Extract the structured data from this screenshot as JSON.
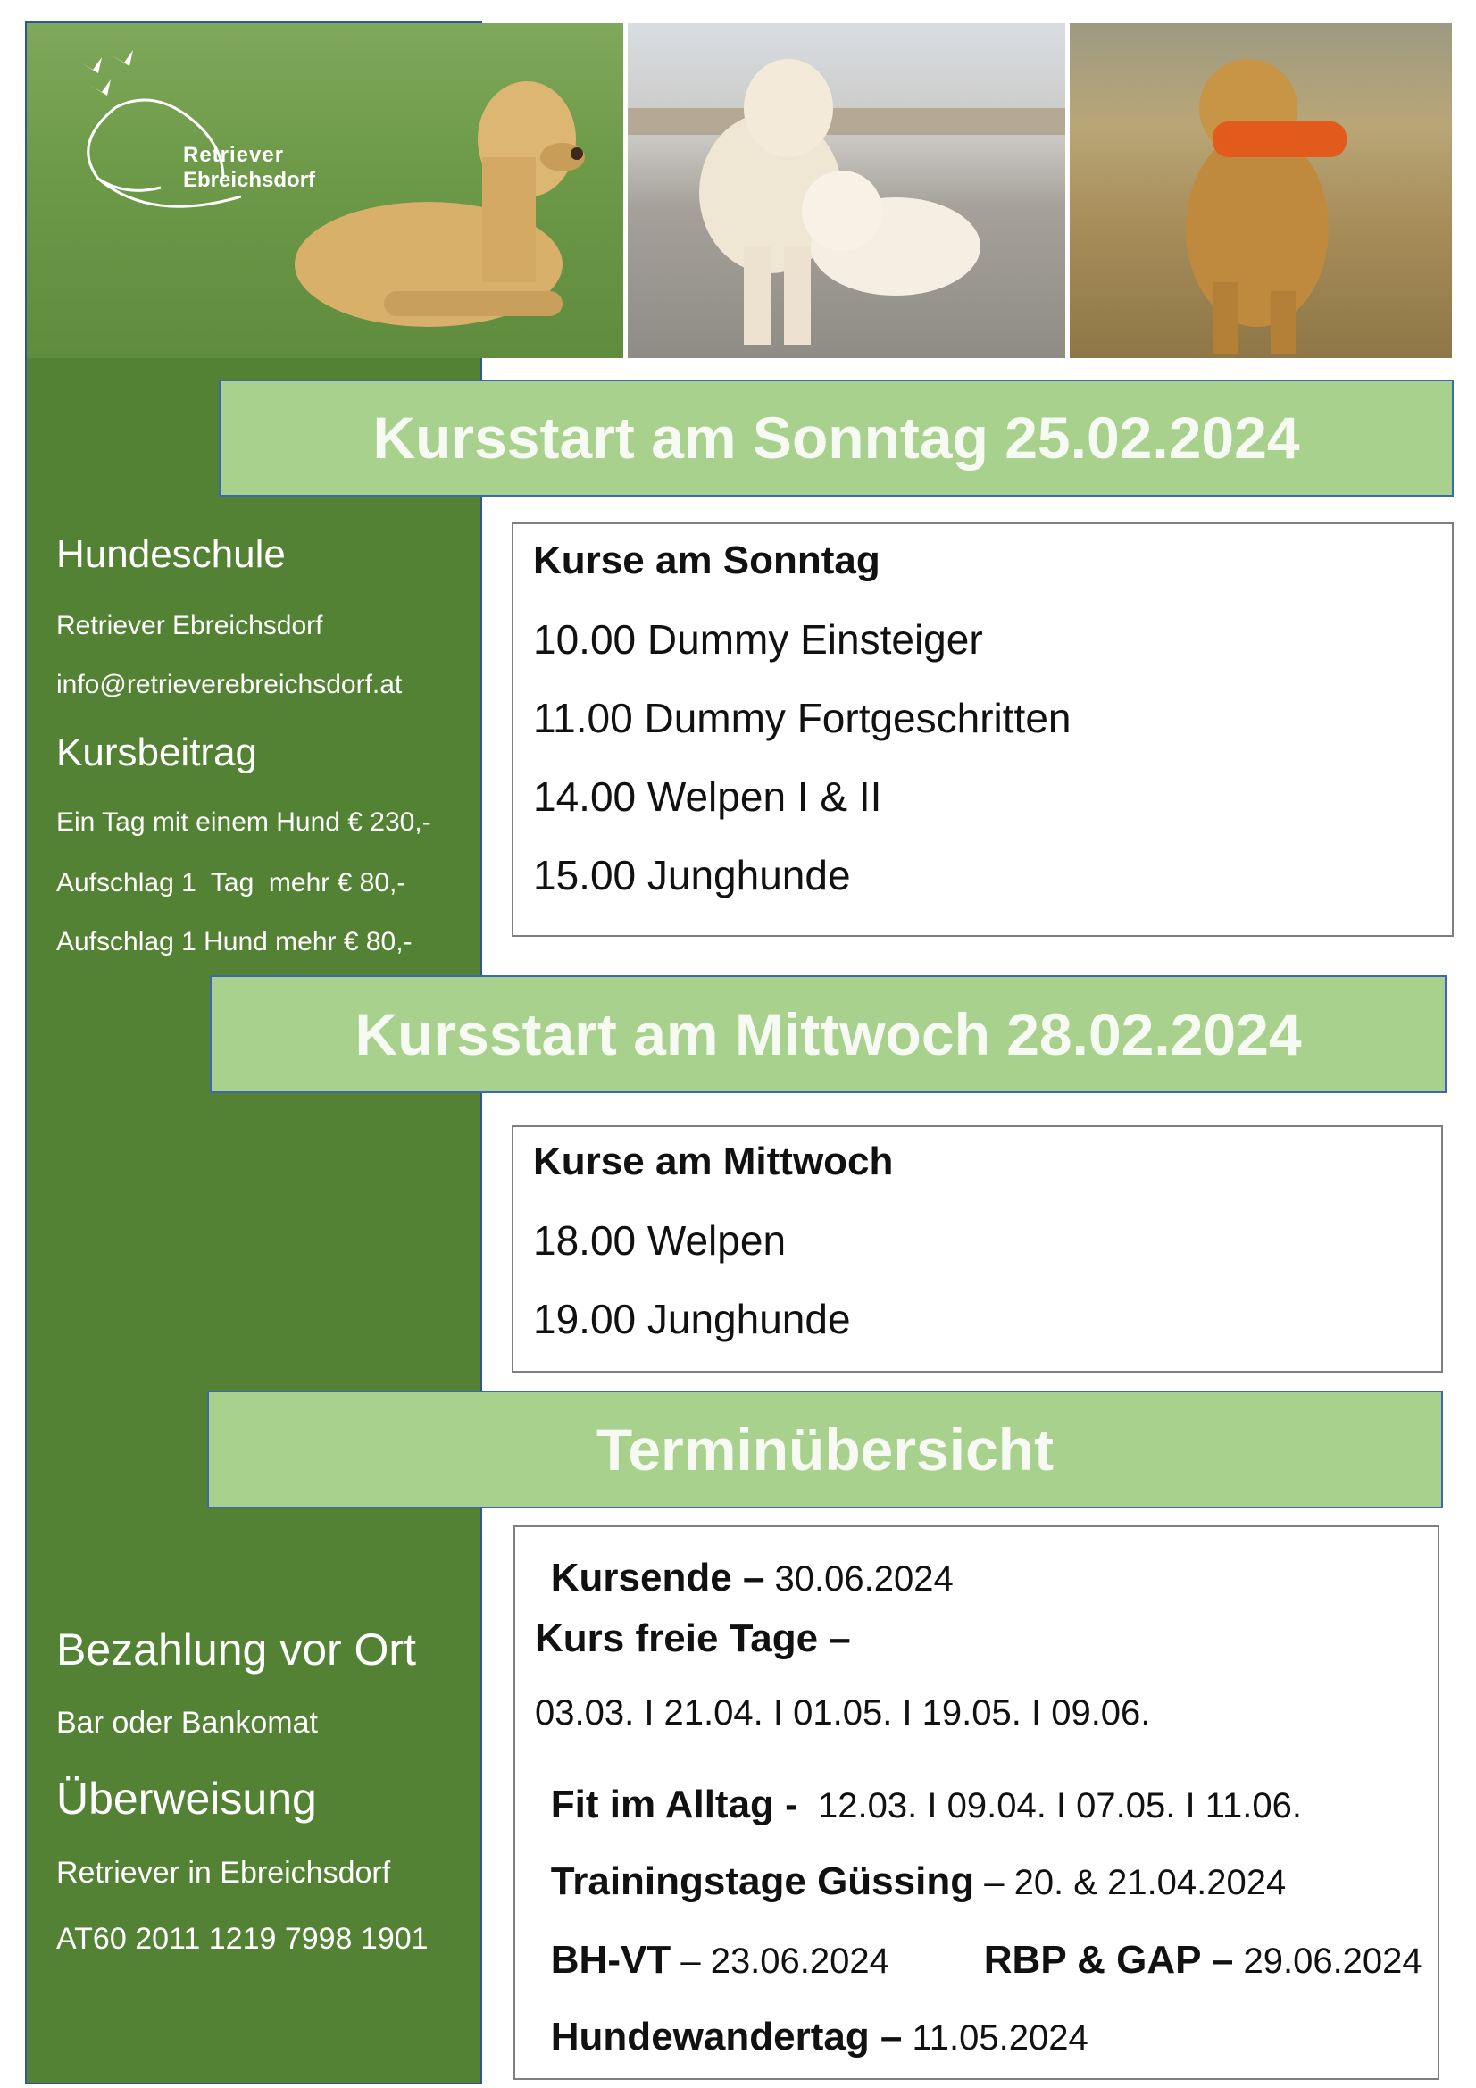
{
  "logo": {
    "line1": "Retriever",
    "line2": "Ebreichsdorf"
  },
  "bands": {
    "sunday": "Kursstart am Sonntag 25.02.2024",
    "wednesday": "Kursstart am Mittwoch 28.02.2024",
    "overview": "Terminübersicht"
  },
  "sidebar": {
    "school_heading": "Hundeschule",
    "school_name": "Retriever Ebreichsdorf",
    "email": "info@retrieverebreichsdorf.at",
    "fee_heading": "Kursbeitrag",
    "fee_1": "Ein Tag mit einem Hund € 230,-",
    "fee_2": "Aufschlag 1  Tag  mehr € 80,-",
    "fee_3": "Aufschlag 1 Hund mehr € 80,-",
    "payment_heading": "Bezahlung vor Ort",
    "payment_methods": "Bar oder Bankomat",
    "transfer_heading": "Überweisung",
    "transfer_name": "Retriever in Ebreichsdorf",
    "iban": "AT60 2011 1219 7998 1901"
  },
  "sunday_courses": {
    "heading": "Kurse am Sonntag",
    "items": [
      "10.00 Dummy Einsteiger",
      "11.00 Dummy Fortgeschritten",
      "14.00 Welpen I & II",
      "15.00 Junghunde"
    ]
  },
  "wednesday_courses": {
    "heading": "Kurse am Mittwoch",
    "items": [
      "18.00 Welpen",
      "19.00 Junghunde"
    ]
  },
  "overview": {
    "end_label": "Kursende –",
    "end_date": " 30.06.2024",
    "free_label": "Kurs freie Tage –",
    "free_dates": "03.03. I 21.04. I 01.05. I 19.05. I 09.06.",
    "fit_label": "Fit im Alltag -",
    "fit_dates": "  12.03. I 09.04. I 07.05. I 11.06.",
    "training_label": "Trainingstage Güssing",
    "training_dates": " – 20. & 21.04.2024",
    "bhvt_label": "BH-VT",
    "bhvt_date": " – 23.06.2024",
    "rbp_label": "RBP & GAP –",
    "rbp_date": " 29.06.2024",
    "hike_label": "Hundewandertag –",
    "hike_date": " 11.05.2024"
  }
}
